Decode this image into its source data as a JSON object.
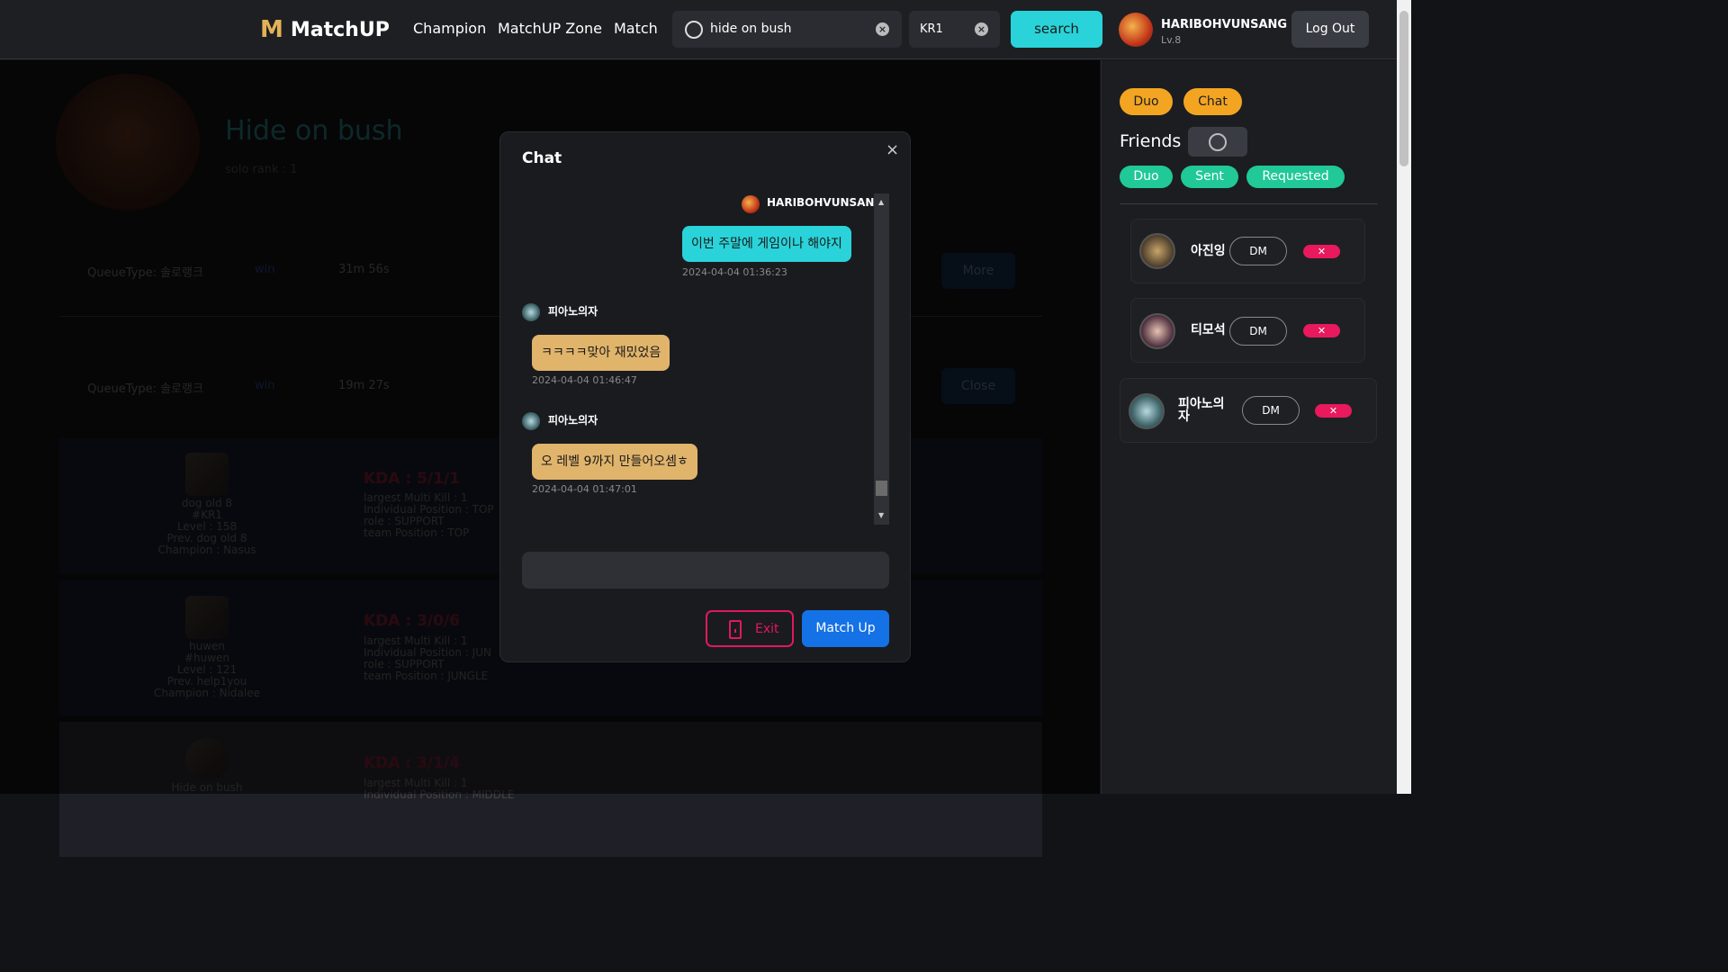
{
  "header": {
    "logo_mark": "M",
    "logo_text": "MatchUP",
    "nav": [
      "Champion",
      "MatchUP Zone",
      "Match"
    ],
    "search_value": "hide on bush",
    "region_value": "KR1",
    "search_button": "search",
    "user_name": "HARIBOHVUNSANG",
    "user_level": "Lv.8",
    "logout_button": "Log Out"
  },
  "profile": {
    "summoner_name": "Hide on bush",
    "solo_rank": "solo rank : 1"
  },
  "matches": [
    {
      "queue": "QueueType: 솔로랭크",
      "result": "win",
      "duration": "31m 56s",
      "button": "More"
    },
    {
      "queue": "QueueType: 솔로랭크",
      "result": "win",
      "duration": "19m 27s",
      "button": "Close"
    }
  ],
  "details": [
    {
      "name": "dog old 8",
      "tag": "#KR1",
      "level": "Level : 158",
      "prev": "Prev. dog old 8",
      "champion": "Champion : Nasus",
      "kda": "KDA : 5/1/1",
      "multikill": "largest Multi Kill : 1",
      "position": "Individual Position : TOP",
      "role": "role : SUPPORT",
      "team_position": "team Position : TOP"
    },
    {
      "name": "huwen",
      "tag": "#huwen",
      "level": "Level : 121",
      "prev": "Prev. help1you",
      "champion": "Champion : Nidalee",
      "kda": "KDA : 3/0/6",
      "multikill": "largest Multi Kill : 1",
      "position": "Individual Position : JUN",
      "role": "role : SUPPORT",
      "team_position": "team Position : JUNGLE"
    },
    {
      "name": "Hide on bush",
      "kda": "KDA : 3/1/4",
      "multikill": "largest Multi Kill : 1",
      "position": "Individual Position : MIDDLE"
    }
  ],
  "sidebar": {
    "tabs": [
      "Duo",
      "Chat"
    ],
    "friends_title": "Friends",
    "filters": [
      "Duo",
      "Sent",
      "Requested"
    ],
    "friends": [
      {
        "name": "아진잉",
        "dm": "DM",
        "remove": "✕"
      },
      {
        "name": "티모석",
        "dm": "DM",
        "remove": "✕"
      },
      {
        "name": "피아노의자",
        "dm": "DM",
        "remove": "✕"
      }
    ]
  },
  "chat": {
    "title": "Chat",
    "close": "×",
    "messages": [
      {
        "sender": "HARIBOHVUNSANG",
        "text": "이번 주말에 게임이나 해야지",
        "time": "2024-04-04 01:36:23",
        "mine": true
      },
      {
        "sender": "피아노의자",
        "text": "ㅋㅋㅋㅋ맞아 재밌었음",
        "time": "2024-04-04 01:46:47",
        "mine": false
      },
      {
        "sender": "피아노의자",
        "text": "오 레벨 9까지 만들어오셈ㅎ",
        "time": "2024-04-04 01:47:01",
        "mine": false
      }
    ],
    "input_placeholder": "",
    "exit_button": "Exit",
    "matchup_button": "Match Up"
  },
  "colors": {
    "accent_teal": "#29d3d9",
    "accent_orange": "#f3a522",
    "danger": "#e0195b",
    "primary_blue": "#1471e6"
  }
}
